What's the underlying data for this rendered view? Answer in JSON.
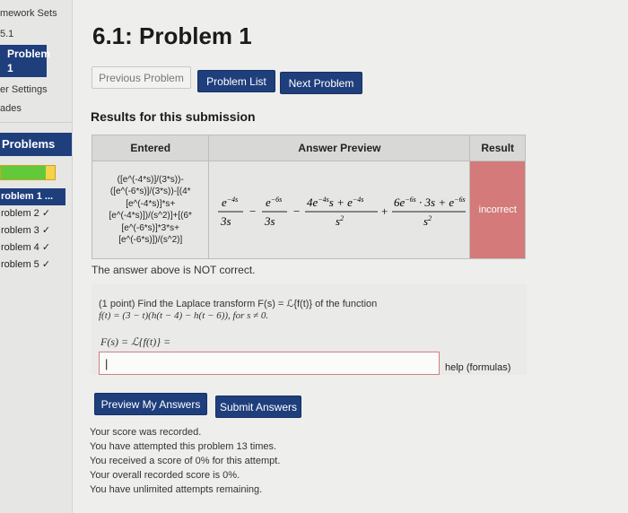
{
  "sidebar": {
    "set_label": "mework Sets",
    "set_number": "5.1",
    "problem_box": {
      "label": "Problem",
      "number": "1"
    },
    "settings": "er Settings",
    "grades": "ades",
    "problems_heading": "Problems",
    "progress_fraction": 0.84,
    "problems": [
      {
        "label": "roblem 1 ..."
      },
      {
        "label": "roblem 2 ✓"
      },
      {
        "label": "roblem 3 ✓"
      },
      {
        "label": "roblem 4 ✓"
      },
      {
        "label": "roblem 5 ✓"
      }
    ]
  },
  "main": {
    "title": "6.1: Problem 1",
    "nav": {
      "previous": "Previous Problem",
      "list": "Problem List",
      "next": "Next Problem"
    },
    "results_heading": "Results for this submission",
    "table": {
      "headers": [
        "Entered",
        "Answer Preview",
        "Result"
      ],
      "entered_lines": [
        "([e^(-4*s)]/(3*s))-",
        "([e^(-6*s)]/(3*s))-[(4*",
        "[e^(-4*s)]*s+",
        "[e^(-4*s)])/(s^2)]+[(6*",
        "[e^(-6*s)]*3*s+",
        "[e^(-6*s)])/(s^2)]"
      ],
      "preview": {
        "t1_num": "e",
        "t1_num_sup": "−4s",
        "t1_den": "3s",
        "op1": "−",
        "t2_num": "e",
        "t2_num_sup": "−6s",
        "t2_den": "3s",
        "op2": "−",
        "t3_num_a": "4e",
        "t3_num_sup1": "−4s",
        "t3_num_b": "s + e",
        "t3_num_sup2": "−4s",
        "t3_den": "s",
        "t3_den_sup": "2",
        "op3": "+",
        "t4_num_a": "6e",
        "t4_num_sup1": "−6s",
        "t4_num_b": " · 3s + e",
        "t4_num_sup2": "−6s",
        "t4_den": "s",
        "t4_den_sup": "2"
      },
      "result": "incorrect"
    },
    "not_correct_msg": "The answer above is NOT correct.",
    "problem": {
      "line1": "(1 point) Find the Laplace transform F(s) = ℒ{f(t)} of the function",
      "line2": "f(t) = (3 − t)(h(t − 4) − h(t − 6)), for s ≠ 0.",
      "line3": "F(s) = ℒ{f(t)} =",
      "input_value": "|",
      "help": "help (formulas)"
    },
    "buttons": {
      "preview": "Preview My Answers",
      "submit": "Submit Answers"
    },
    "score_lines": [
      "Your score was recorded.",
      "You have attempted this problem 13 times.",
      "You received a score of 0% for this attempt.",
      "Your overall recorded score is 0%.",
      "You have unlimited attempts remaining."
    ]
  }
}
